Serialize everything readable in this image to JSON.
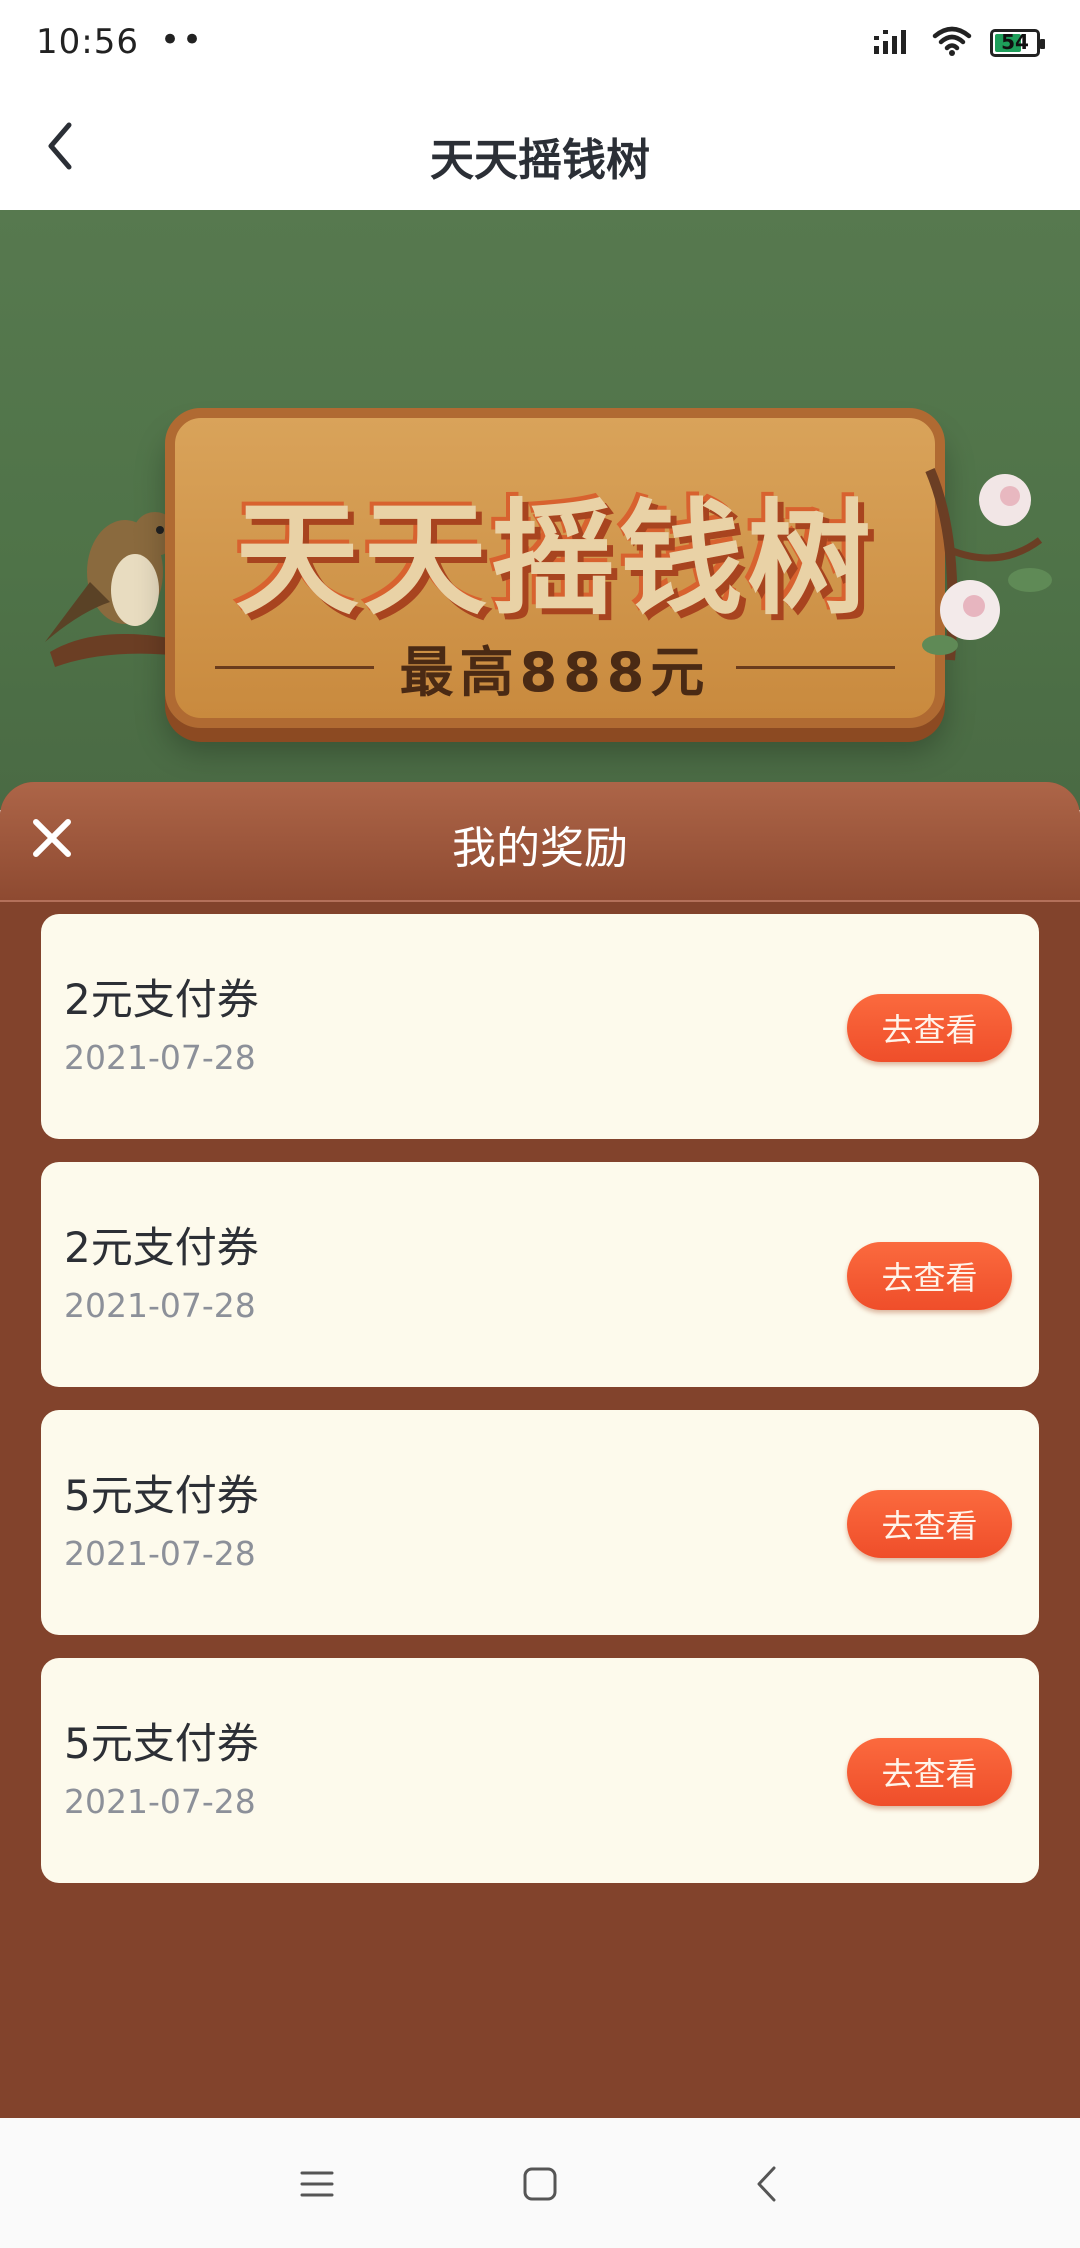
{
  "status_bar": {
    "time": "10:56",
    "dots": "••",
    "battery_level": "54"
  },
  "nav": {
    "title": "天天摇钱树"
  },
  "banner": {
    "title": "天天摇钱树",
    "subtitle": "最高888元"
  },
  "sheet": {
    "title": "我的奖励",
    "rewards": [
      {
        "name": "2元支付券",
        "date": "2021-07-28",
        "button": "去查看"
      },
      {
        "name": "2元支付券",
        "date": "2021-07-28",
        "button": "去查看"
      },
      {
        "name": "5元支付券",
        "date": "2021-07-28",
        "button": "去查看"
      },
      {
        "name": "5元支付券",
        "date": "2021-07-28",
        "button": "去查看"
      }
    ]
  },
  "icons": {
    "back": "chevron-left-icon",
    "close": "close-icon",
    "signal": "signal-icon",
    "wifi": "wifi-icon",
    "battery": "battery-icon",
    "sys_menu": "menu-icon",
    "sys_home": "home-icon",
    "sys_back": "back-icon"
  },
  "colors": {
    "sheet_bg": "#82432c",
    "card_bg": "#fdfaec",
    "button": "#f05a30",
    "banner_bg": "#57794f"
  }
}
